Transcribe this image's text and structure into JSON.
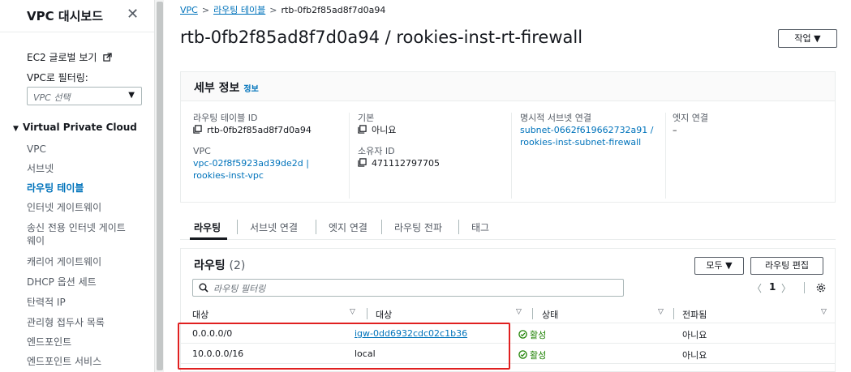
{
  "sidebar": {
    "title": "VPC 대시보드",
    "close_glyph": "✕",
    "ec2_global_view": "EC2 글로벌 보기",
    "filter_label": "VPC로 필터링:",
    "filter_placeholder": "VPC 선택",
    "section": "Virtual Private Cloud",
    "items": [
      {
        "label": "VPC"
      },
      {
        "label": "서브넷"
      },
      {
        "label": "라우팅 테이블",
        "active": true
      },
      {
        "label": "인터넷 게이트웨이"
      },
      {
        "label": "송신 전용 인터넷 게이트"
      },
      {
        "label": "웨이"
      },
      {
        "label": "캐리어 게이트웨이"
      },
      {
        "label": "DHCP 옵션 세트"
      },
      {
        "label": "탄력적 IP"
      },
      {
        "label": "관리형 접두사 목록"
      },
      {
        "label": "엔드포인트"
      },
      {
        "label": "엔드포인트 서비스"
      }
    ]
  },
  "breadcrumb": {
    "root": "VPC",
    "section": "라우팅 테이블",
    "current": "rtb-0fb2f85ad8f7d0a94",
    "sep": ">"
  },
  "header": {
    "title": "rtb-0fb2f85ad8f7d0a94 / rookies-inst-rt-firewall",
    "action_label": "작업 ▼"
  },
  "details": {
    "title": "세부 정보",
    "info_link": "정보",
    "route_table_id_label": "라우팅 테이블 ID",
    "route_table_id": "rtb-0fb2f85ad8f7d0a94",
    "vpc_label": "VPC",
    "vpc_value_line1": "vpc-02f8f5923ad39de2d |",
    "vpc_value_line2": "rookies-inst-vpc",
    "main_label": "기본",
    "main_value": "아니요",
    "owner_label": "소유자 ID",
    "owner_value": "471112797705",
    "explicit_subnet_label": "명시적 서브넷 연결",
    "explicit_subnet_line1": "subnet-0662f619662732a91 /",
    "explicit_subnet_line2": "rookies-inst-subnet-firewall",
    "edge_label": "엣지 연결",
    "edge_value": "–"
  },
  "tabs": [
    "라우팅",
    "서브넷 연결",
    "엣지 연결",
    "라우팅 전파",
    "태그"
  ],
  "routes": {
    "title": "라우팅",
    "count": "(2)",
    "filter_all_label": "모두 ▼",
    "edit_label": "라우팅 편집",
    "search_placeholder": "라우팅 필터링",
    "page": "1",
    "prev": "〈",
    "next": "〉",
    "columns": [
      "대상",
      "대상",
      "상태",
      "전파됨"
    ],
    "sort_glyph": "▽",
    "rows": [
      {
        "destination": "0.0.0.0/0",
        "target": "igw-0dd6932cdc02c1b36",
        "status": "활성",
        "propagated": "아니요"
      },
      {
        "destination": "10.0.0.0/16",
        "target": "local",
        "status": "활성",
        "propagated": "아니요"
      }
    ]
  },
  "colors": {
    "link": "#0073bb",
    "active_status": "#1d8102",
    "highlight_box": "#e02020"
  }
}
